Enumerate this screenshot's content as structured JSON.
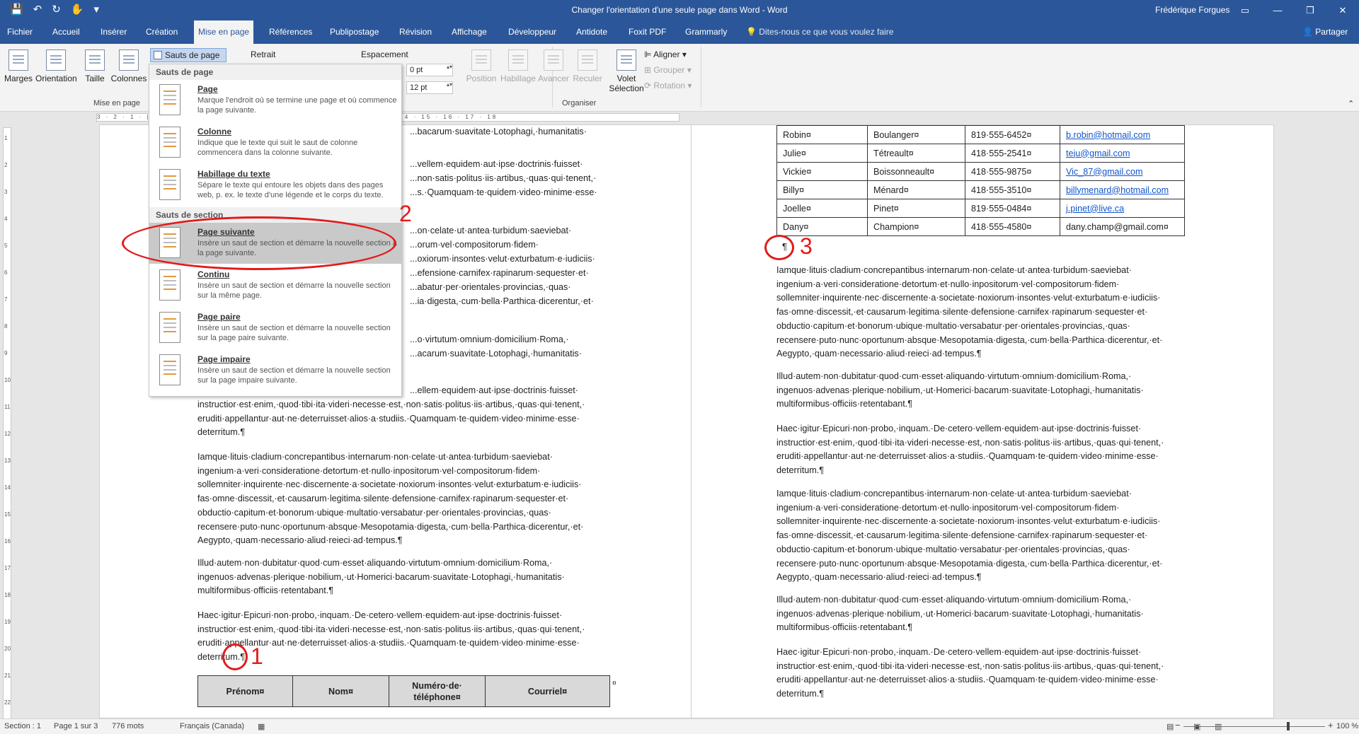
{
  "window": {
    "title": "Changer l'orientation d'une seule page dans Word  -  Word",
    "user": "Frédérique Forgues",
    "controls": [
      "▭",
      "—",
      "❐",
      "✕"
    ]
  },
  "qat": [
    "💾",
    "↶",
    "↻",
    "✋",
    "▾"
  ],
  "tabs": [
    "Fichier",
    "Accueil",
    "Insérer",
    "Création",
    "Mise en page",
    "Références",
    "Publipostage",
    "Révision",
    "Affichage",
    "Développeur",
    "Antidote",
    "Foxit PDF",
    "Grammarly"
  ],
  "active_tab": "Mise en page",
  "tell_me": "Dites-nous ce que vous voulez faire",
  "share": "Partager",
  "ribbon": {
    "buttons": [
      "Marges",
      "Orientation",
      "Taille",
      "Colonnes"
    ],
    "group_mise_en_page": "Mise en page",
    "sauts_label": "Sauts de page",
    "retrait_label": "Retrait",
    "espacement_label": "Espacement",
    "espacement_avant": "0 pt",
    "espacement_apres": "12 pt",
    "arrange_buttons": [
      "Position",
      "Habillage",
      "Avancer",
      "Reculer"
    ],
    "volet": "Volet",
    "selection": "Sélection",
    "aligner": "Aligner",
    "grouper": "Grouper",
    "rotation": "Rotation",
    "group_organiser": "Organiser"
  },
  "ruler_text": "3 · 2 · 1 · | · 1 · 2 · 3 · 4 · 5 · 6 · 7 · 8 · 9 · 10 · 11 · 12 · 13 · 14 · 15 · 16 · 17 · 18",
  "vruler_ticks": [
    "1",
    "2",
    "3",
    "4",
    "5",
    "6",
    "7",
    "8",
    "9",
    "10",
    "11",
    "12",
    "13",
    "14",
    "15",
    "16",
    "17",
    "18",
    "19",
    "20",
    "21",
    "22"
  ],
  "dropdown": {
    "header_page": "Sauts de page",
    "header_section": "Sauts de section",
    "items": [
      {
        "title": "Page",
        "desc": "Marque l'endroit où se termine une page et où commence la page suivante."
      },
      {
        "title": "Colonne",
        "desc": "Indique que le texte qui suit le saut de colonne commencera dans la colonne suivante."
      },
      {
        "title": "Habillage du texte",
        "desc": "Sépare le texte qui entoure les objets dans des pages web, p. ex. le texte d'une légende et le corps du texte."
      },
      {
        "title": "Page suivante",
        "desc": "Insère un saut de section et démarre la nouvelle section à la page suivante."
      },
      {
        "title": "Continu",
        "desc": "Insère un saut de section et démarre la nouvelle section sur la même page."
      },
      {
        "title": "Page paire",
        "desc": "Insère un saut de section et démarre la nouvelle section sur la page paire suivante."
      },
      {
        "title": "Page impaire",
        "desc": "Insère un saut de section et démarre la nouvelle section sur la page impaire suivante."
      }
    ]
  },
  "left_page": {
    "top_fragment": "...bacarum·suavitate·Lotophagi,·humanitatis·",
    "frag_lines": [
      "...vellem·equidem·aut·ipse·doctrinis·fuisset·",
      "...non·satis·politus·iis·artibus,·quas·qui·tenent,·",
      "...s.·Quamquam·te·quidem·video·minime·esse·",
      "...on·celate·ut·antea·turbidum·saeviebat·",
      "...orum·vel·compositorum·fidem·",
      "...oxiorum·insontes·velut·exturbatum·e·iudiciis·",
      "...efensione·carnifex·rapinarum·sequester·et·",
      "...abatur·per·orientales·provincias,·quas·",
      "...ia·digesta,·cum·bella·Parthica·dicerentur,·et·",
      "...o·virtutum·omnium·domicilium·Roma,·",
      "...acarum·suavitate·Lotophagi,·humanitatis·",
      "...ellem·equidem·aut·ipse·doctrinis·fuisset·"
    ],
    "p_haec_a": "instructior·est·enim,·quod·tibi·ita·videri·necesse·est,·non·satis·politus·iis·artibus,·quas·qui·tenent,· eruditi·appellantur·aut·ne·deterruisset·alios·a·studiis.·Quamquam·te·quidem·video·minime·esse· deterritum.¶",
    "p_iamque": "Iamque·lituis·cladium·concrepantibus·internarum·non·celate·ut·antea·turbidum·saeviebat· ingenium·a·veri·consideratione·detortum·et·nullo·inpositorum·vel·compositorum·fidem· sollemniter·inquirente·nec·discernente·a·societate·noxiorum·insontes·velut·exturbatum·e·iudiciis· fas·omne·discessit,·et·causarum·legitima·silente·defensione·carnifex·rapinarum·sequester·et· obductio·capitum·et·bonorum·ubique·multatio·versabatur·per·orientales·provincias,·quas· recensere·puto·nunc·oportunum·absque·Mesopotamia·digesta,·cum·bella·Parthica·dicerentur,·et· Aegypto,·quam·necessario·aliud·reieci·ad·tempus.¶",
    "p_illud": "Illud·autem·non·dubitatur·quod·cum·esset·aliquando·virtutum·omnium·domicilium·Roma,· ingenuos·advenas·plerique·nobilium,·ut·Homerici·bacarum·suavitate·Lotophagi,·humanitatis· multiformibus·officiis·retentabant.¶",
    "p_haec_b": "Haec·igitur·Epicuri·non·probo,·inquam.·De·cetero·vellem·equidem·aut·ipse·doctrinis·fuisset· instructior·est·enim,·quod·tibi·ita·videri·necesse·est,·non·satis·politus·iis·artibus,·quas·qui·tenent,· eruditi·appellantur·aut·ne·deterruisset·alios·a·studiis.·Quamquam·te·quidem·video·minime·esse· deterritum.¶",
    "table_headers": [
      "Prénom¤",
      "Nom¤",
      "Numéro·de· téléphone¤",
      "Courriel¤"
    ],
    "end_cell_mark": "¤"
  },
  "right_page": {
    "rows": [
      {
        "first": "Robin¤",
        "last": "Boulanger¤",
        "phone": "819·555-6452¤",
        "email": "b.robin@hotmail.com",
        "link": true
      },
      {
        "first": "Julie¤",
        "last": "Tétreault¤",
        "phone": "418·555-2541¤",
        "email": "teju@gmail.com",
        "link": true
      },
      {
        "first": "Vickie¤",
        "last": "Boissonneault¤",
        "phone": "418·555-9875¤",
        "email": "Vic_87@gmail.com",
        "link": true
      },
      {
        "first": "Billy¤",
        "last": "Ménard¤",
        "phone": "418·555-3510¤",
        "email": "billymenard@hotmail.com",
        "link": true
      },
      {
        "first": "Joelle¤",
        "last": "Pinet¤",
        "phone": "819·555-0484¤",
        "email": "j.pinet@live.ca",
        "link": true
      },
      {
        "first": "Dany¤",
        "last": "Champion¤",
        "phone": "418·555-4580¤",
        "email": "dany.champ@gmail.com¤",
        "link": false
      }
    ],
    "pilcrow": "¶",
    "p1": "Iamque·lituis·cladium·concrepantibus·internarum·non·celate·ut·antea·turbidum·saeviebat· ingenium·a·veri·consideratione·detortum·et·nullo·inpositorum·vel·compositorum·fidem· sollemniter·inquirente·nec·discernente·a·societate·noxiorum·insontes·velut·exturbatum·e·iudiciis· fas·omne·discessit,·et·causarum·legitima·silente·defensione·carnifex·rapinarum·sequester·et· obductio·capitum·et·bonorum·ubique·multatio·versabatur·per·orientales·provincias,·quas· recensere·puto·nunc·oportunum·absque·Mesopotamia·digesta,·cum·bella·Parthica·dicerentur,·et· Aegypto,·quam·necessario·aliud·reieci·ad·tempus.¶",
    "p2": "Illud·autem·non·dubitatur·quod·cum·esset·aliquando·virtutum·omnium·domicilium·Roma,· ingenuos·advenas·plerique·nobilium,·ut·Homerici·bacarum·suavitate·Lotophagi,·humanitatis· multiformibus·officiis·retentabant.¶",
    "p3": "Haec·igitur·Epicuri·non·probo,·inquam.·De·cetero·vellem·equidem·aut·ipse·doctrinis·fuisset· instructior·est·enim,·quod·tibi·ita·videri·necesse·est,·non·satis·politus·iis·artibus,·quas·qui·tenent,· eruditi·appellantur·aut·ne·deterruisset·alios·a·studiis.·Quamquam·te·quidem·video·minime·esse· deterritum.¶",
    "p4": "Iamque·lituis·cladium·concrepantibus·internarum·non·celate·ut·antea·turbidum·saeviebat· ingenium·a·veri·consideratione·detortum·et·nullo·inpositorum·vel·compositorum·fidem· sollemniter·inquirente·nec·discernente·a·societate·noxiorum·insontes·velut·exturbatum·e·iudiciis· fas·omne·discessit,·et·causarum·legitima·silente·defensione·carnifex·rapinarum·sequester·et· obductio·capitum·et·bonorum·ubique·multatio·versabatur·per·orientales·provincias,·quas· recensere·puto·nunc·oportunum·absque·Mesopotamia·digesta,·cum·bella·Parthica·dicerentur,·et· Aegypto,·quam·necessario·aliud·reieci·ad·tempus.¶",
    "p5": "Illud·autem·non·dubitatur·quod·cum·esset·aliquando·virtutum·omnium·domicilium·Roma,· ingenuos·advenas·plerique·nobilium,·ut·Homerici·bacarum·suavitate·Lotophagi,·humanitatis· multiformibus·officiis·retentabant.¶",
    "p6": "Haec·igitur·Epicuri·non·probo,·inquam.·De·cetero·vellem·equidem·aut·ipse·doctrinis·fuisset· instructior·est·enim,·quod·tibi·ita·videri·necesse·est,·non·satis·politus·iis·artibus,·quas·qui·tenent,· eruditi·appellantur·aut·ne·deterruisset·alios·a·studiis.·Quamquam·te·quidem·video·minime·esse· deterritum.¶"
  },
  "annotations": [
    "1",
    "2",
    "3"
  ],
  "status": {
    "section": "Section : 1",
    "page": "Page 1 sur 3",
    "words": "776 mots",
    "language": "Français (Canada)",
    "zoom": "100 %",
    "zoom_minus": "−",
    "zoom_plus": "+"
  },
  "colors": {
    "word_blue": "#2b579a",
    "annotation_red": "#e21b1b",
    "hover_gray": "#c9c9c9"
  }
}
